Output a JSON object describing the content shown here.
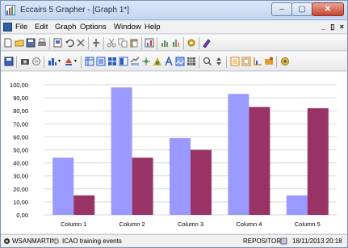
{
  "window": {
    "title": "Eccairs 5 Grapher - [Graph 1*]",
    "caption_minimize": "–",
    "caption_maximize": "▢",
    "caption_close": "✕",
    "mdi_controls": "_ ▯ ×"
  },
  "menu": {
    "items": [
      "File",
      "Edit",
      "Graph",
      "Options",
      "Window",
      "Help"
    ]
  },
  "toolbar1": {
    "icons": [
      "new-icon",
      "open-icon",
      "save-icon",
      "print-icon",
      "preview-icon",
      "undo-icon",
      "delete-icon",
      "pin-icon",
      "cut-icon",
      "copy-icon",
      "paste-icon",
      "chart-wizard-icon",
      "graph-icon",
      "graph-alt-icon",
      "settings-icon",
      "palette-icon"
    ]
  },
  "toolbar2": {
    "icons": [
      "save-graph-icon",
      "camera-icon",
      "export-icon",
      "bar-chart-icon",
      "fill-icon",
      "table-icon",
      "list-icon",
      "grid-icon",
      "layout-icon",
      "link-icon",
      "move-icon",
      "style-icon",
      "text-icon",
      "picture-icon",
      "grid2-icon",
      "zoom-icon",
      "sort-icon",
      "frame-icon",
      "frame2-icon",
      "axis-icon",
      "options-icon",
      "color-icon"
    ]
  },
  "colors": {
    "series1": "#9999ff",
    "series2": "#993366",
    "grid": "#d8d8d8"
  },
  "chart_data": {
    "type": "bar",
    "categories": [
      "Column 1",
      "Column 2",
      "Column 3",
      "Column 4",
      "Column 5"
    ],
    "series": [
      {
        "values": [
          44,
          98,
          59,
          93,
          15
        ]
      },
      {
        "values": [
          15,
          44,
          50,
          83,
          82
        ]
      }
    ],
    "ylim": [
      0,
      100
    ],
    "yticks": [
      "0,00",
      "10,00",
      "20,00",
      "30,00",
      "40,00",
      "50,00",
      "60,00",
      "70,00",
      "80,00",
      "90,00",
      "100,00"
    ],
    "grid": true
  },
  "status": {
    "user": "WSANMARTIN",
    "project": "ICAO training events",
    "repository": "REPOSITORY",
    "datetime": "18/11/2013  20:18"
  }
}
